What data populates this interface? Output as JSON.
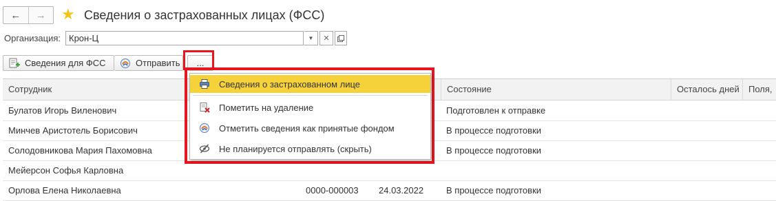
{
  "header": {
    "title": "Сведения о застрахованных лицах (ФСС)",
    "back_icon": "←",
    "forward_icon": "→",
    "star_icon": "★"
  },
  "org": {
    "label": "Организация:",
    "value": "Крон-Ц"
  },
  "toolbar": {
    "svedeniya_label": "Сведения для ФСС",
    "send_label": "Отправить",
    "more_label": "..."
  },
  "table": {
    "columns": [
      "Сотрудник",
      "",
      "",
      "Состояние",
      "Осталось дней",
      "Поля,"
    ],
    "rows": [
      {
        "employee": "Булатов Игорь Виленович",
        "number": "",
        "date": "",
        "state": "Подготовлен к отправке"
      },
      {
        "employee": "Минчев Аристотель Борисович",
        "number": "",
        "date": "",
        "state": "В процессе подготовки"
      },
      {
        "employee": "Солодовникова Мария Пахомовна",
        "number": "",
        "date": "",
        "state": "В процессе подготовки"
      },
      {
        "employee": "Мейерсон Софья Карловна",
        "number": "",
        "date": "",
        "state": ""
      },
      {
        "employee": "Орлова Елена Николаевна",
        "number": "0000-000003",
        "date": "24.03.2022",
        "state": "В процессе подготовки"
      }
    ]
  },
  "menu": {
    "items": [
      {
        "label": "Сведения о застрахованном лице",
        "icon": "printer-icon"
      },
      {
        "label": "Пометить на удаление",
        "icon": "delete-mark-icon"
      },
      {
        "label": "Отметить сведения как принятые фондом",
        "icon": "fss-logo-icon"
      },
      {
        "label": "Не планируется отправлять (скрыть)",
        "icon": "hide-icon"
      }
    ]
  },
  "colors": {
    "accent_highlight": "#e5161e",
    "menu_selection": "#f6d23a",
    "star": "#f2c518"
  }
}
